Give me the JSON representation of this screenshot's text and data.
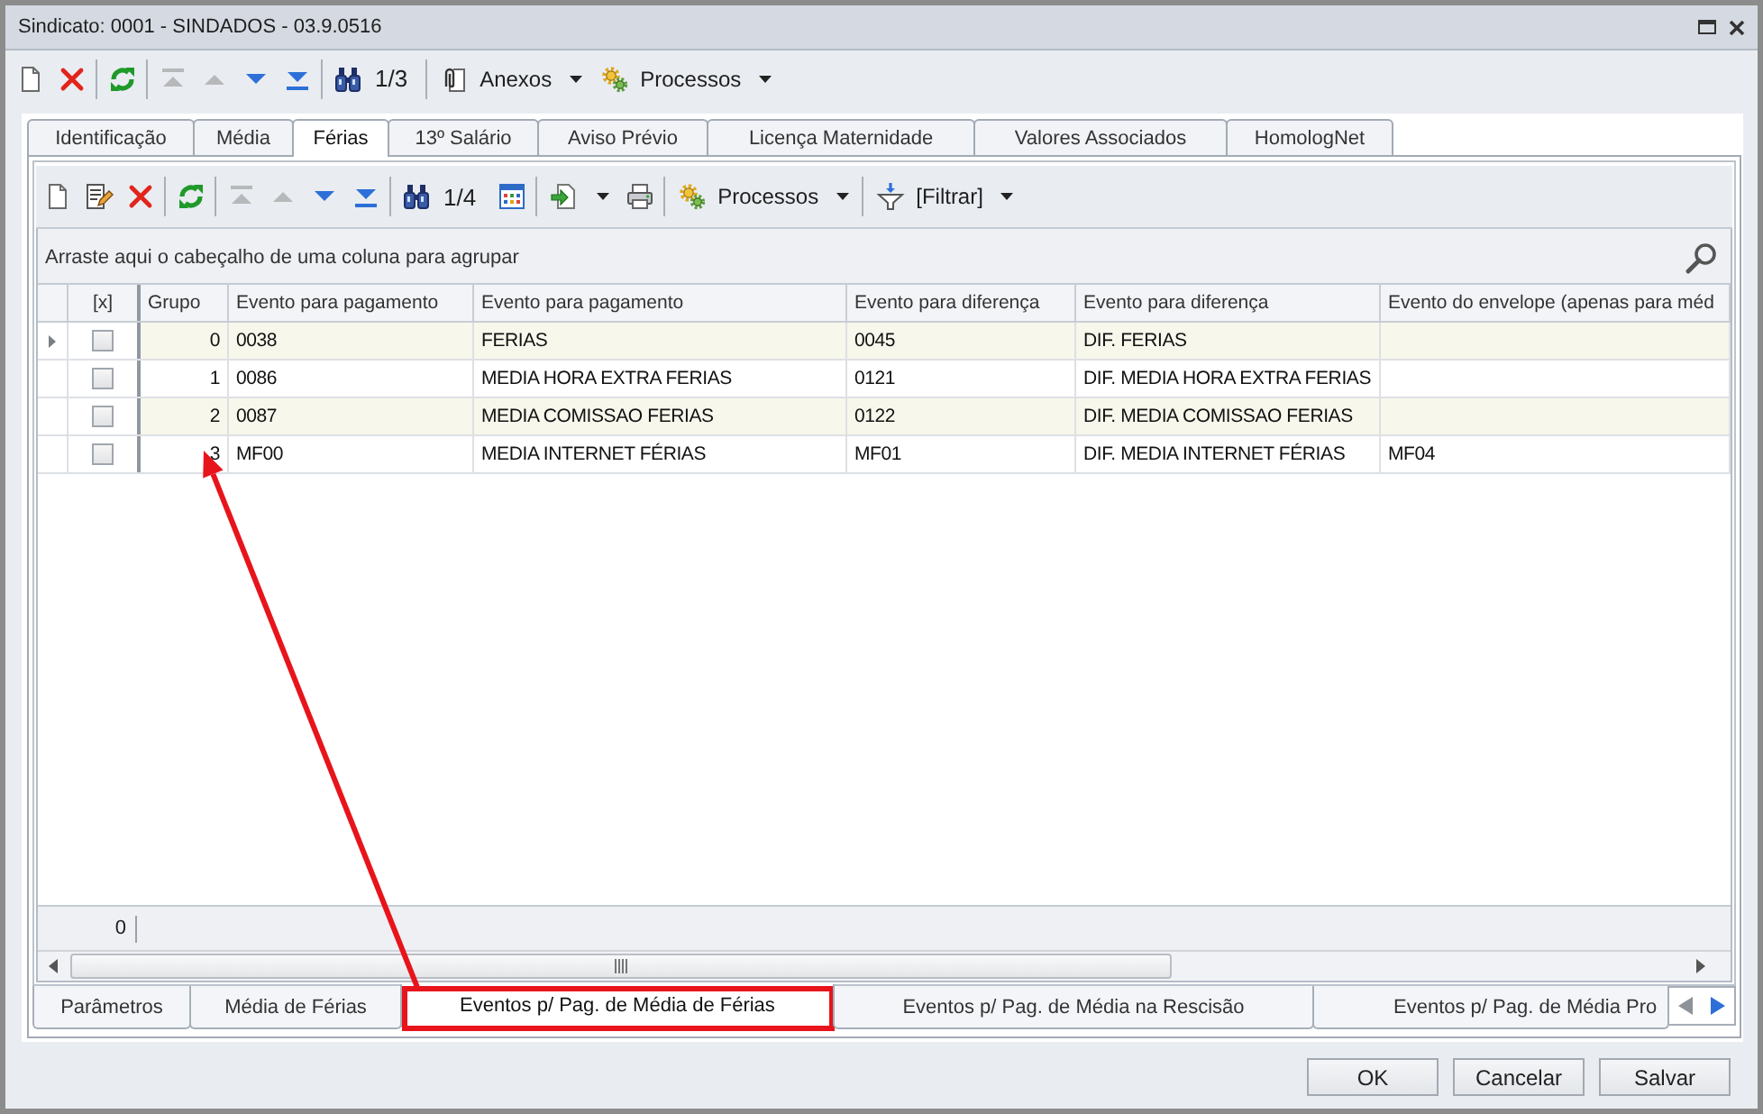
{
  "window": {
    "title": "Sindicato: 0001 - SINDADOS - 03.9.0516"
  },
  "toolbar": [
    {
      "kind": "new",
      "disabled": false
    },
    {
      "kind": "delete",
      "disabled": false
    },
    {
      "kind": "separator"
    },
    {
      "kind": "refresh",
      "disabled": false
    },
    {
      "kind": "separator"
    },
    {
      "kind": "first",
      "disabled": true
    },
    {
      "kind": "previous",
      "disabled": true
    },
    {
      "kind": "next",
      "disabled": false
    },
    {
      "kind": "last",
      "disabled": false
    },
    {
      "kind": "separator"
    },
    {
      "kind": "find",
      "disabled": false
    },
    {
      "kind": "counter",
      "text": "1/3"
    },
    {
      "kind": "separator"
    },
    {
      "kind": "attachments",
      "label": "Anexos",
      "dropdown": true,
      "disabled": false
    },
    {
      "kind": "processes",
      "label": "Processos",
      "dropdown": true,
      "disabled": false
    }
  ],
  "tabs": [
    {
      "label": "Identificação",
      "selected": false
    },
    {
      "label": "Média",
      "selected": false
    },
    {
      "label": "Férias",
      "selected": true
    },
    {
      "label": "13º Salário",
      "selected": false
    },
    {
      "label": "Aviso Prévio",
      "selected": false
    },
    {
      "label": "Licença Maternidade",
      "selected": false
    },
    {
      "label": "Valores Associados",
      "selected": false
    },
    {
      "label": "HomologNet",
      "selected": false
    }
  ],
  "panel": {
    "toolbar": [
      {
        "kind": "new",
        "disabled": false
      },
      {
        "kind": "edit",
        "disabled": false
      },
      {
        "kind": "delete",
        "disabled": false
      },
      {
        "kind": "separator"
      },
      {
        "kind": "refresh",
        "disabled": false
      },
      {
        "kind": "separator"
      },
      {
        "kind": "first",
        "disabled": true
      },
      {
        "kind": "previous",
        "disabled": true
      },
      {
        "kind": "next",
        "disabled": false
      },
      {
        "kind": "last",
        "disabled": false
      },
      {
        "kind": "separator"
      },
      {
        "kind": "find",
        "disabled": false
      },
      {
        "kind": "counter",
        "text": "1/4"
      },
      {
        "kind": "grid",
        "disabled": false
      },
      {
        "kind": "separator"
      },
      {
        "kind": "export",
        "dropdown": true,
        "disabled": false
      },
      {
        "kind": "print",
        "disabled": false
      },
      {
        "kind": "separator"
      },
      {
        "kind": "processes",
        "label": "Processos",
        "dropdown": true,
        "disabled": false
      },
      {
        "kind": "separator"
      },
      {
        "kind": "filter",
        "label": "[Filtrar]",
        "dropdown": true,
        "disabled": false
      }
    ],
    "grid": {
      "group_hint": "Arraste aqui o cabeçalho de uma coluna para agrupar",
      "check_column": "[x]",
      "columns": [
        "Grupo",
        "Evento para pagamento",
        "Evento para pagamento",
        "Evento para diferença",
        "Evento para diferença",
        "Evento do envelope (apenas para méd"
      ],
      "rows": [
        {
          "selected": true,
          "checked": false,
          "cells": [
            "0",
            "0038",
            "FERIAS",
            "0045",
            "DIF. FERIAS"
          ]
        },
        {
          "selected": false,
          "checked": false,
          "cells": [
            "1",
            "0086",
            "MEDIA HORA EXTRA FERIAS",
            "0121",
            "DIF. MEDIA HORA EXTRA FERIAS"
          ]
        },
        {
          "selected": false,
          "checked": false,
          "cells": [
            "2",
            "0087",
            "MEDIA COMISSAO FERIAS",
            "0122",
            "DIF. MEDIA COMISSAO FERIAS"
          ]
        },
        {
          "selected": false,
          "checked": false,
          "cells": [
            "3",
            "MF00",
            "MEDIA INTERNET FÉRIAS",
            "MF01",
            "DIF. MEDIA INTERNET FÉRIAS",
            "MF04"
          ]
        }
      ],
      "summary": "0"
    },
    "bottom_tabs": [
      {
        "label": "Parâmetros",
        "selected": false,
        "highlighted": false
      },
      {
        "label": "Média de Férias",
        "selected": false,
        "highlighted": false
      },
      {
        "label": "Eventos p/ Pag. de Média de Férias",
        "selected": true,
        "highlighted": true
      },
      {
        "label": "Eventos p/ Pag. de Média na Rescisão",
        "selected": false,
        "highlighted": false
      },
      {
        "label": "Eventos p/ Pag. de Média Pro",
        "selected": false,
        "highlighted": false
      }
    ]
  },
  "callout_arrow": true,
  "buttons": [
    "OK",
    "Cancelar",
    "Salvar"
  ]
}
